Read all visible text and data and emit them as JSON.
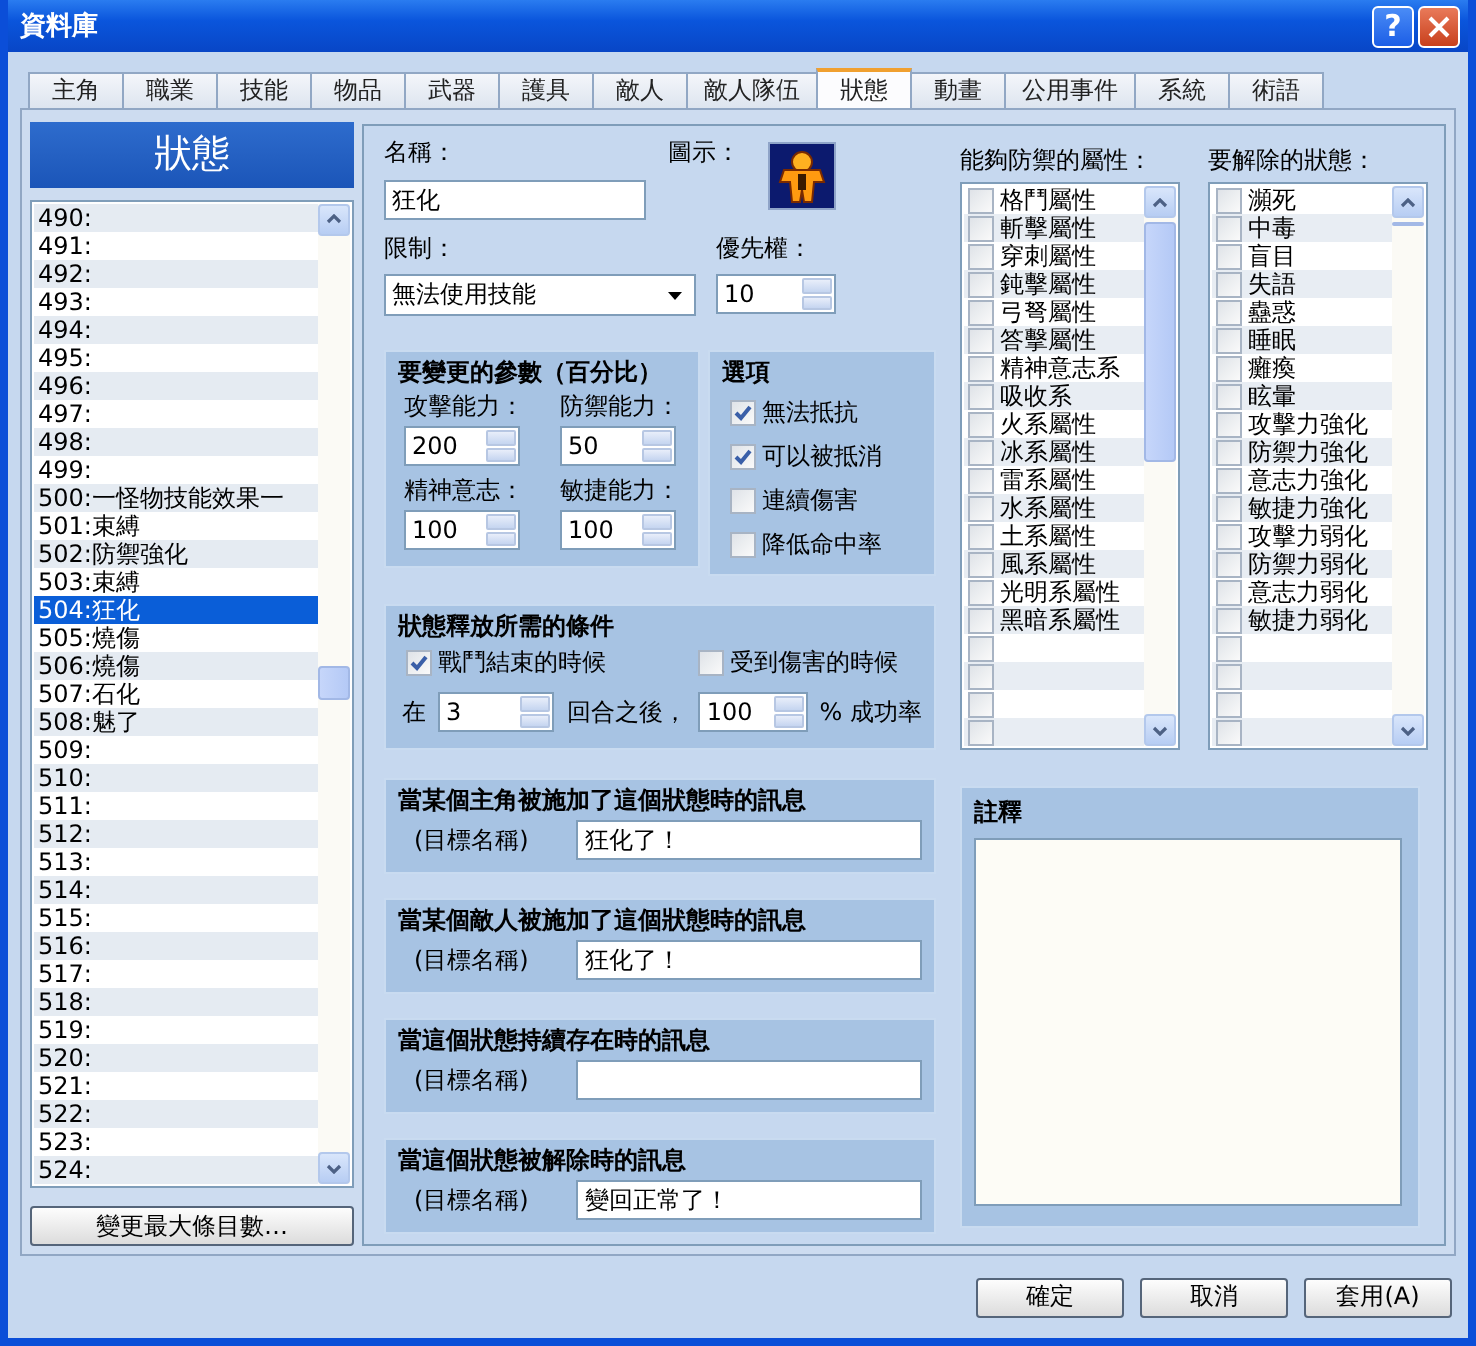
{
  "window": {
    "title": "資料庫",
    "help": "?"
  },
  "tabs": [
    {
      "label": "主角",
      "selected": false
    },
    {
      "label": "職業",
      "selected": false
    },
    {
      "label": "技能",
      "selected": false
    },
    {
      "label": "物品",
      "selected": false
    },
    {
      "label": "武器",
      "selected": false
    },
    {
      "label": "護具",
      "selected": false
    },
    {
      "label": "敵人",
      "selected": false
    },
    {
      "label": "敵人隊伍",
      "selected": false
    },
    {
      "label": "狀態",
      "selected": true
    },
    {
      "label": "動畫",
      "selected": false
    },
    {
      "label": "公用事件",
      "selected": false
    },
    {
      "label": "系統",
      "selected": false
    },
    {
      "label": "術語",
      "selected": false
    }
  ],
  "sidebar": {
    "title": "狀態",
    "button": "變更最大條目數…",
    "items": [
      {
        "label": "490:",
        "selected": false
      },
      {
        "label": "491:",
        "selected": false
      },
      {
        "label": "492:",
        "selected": false
      },
      {
        "label": "493:",
        "selected": false
      },
      {
        "label": "494:",
        "selected": false
      },
      {
        "label": "495:",
        "selected": false
      },
      {
        "label": "496:",
        "selected": false
      },
      {
        "label": "497:",
        "selected": false
      },
      {
        "label": "498:",
        "selected": false
      },
      {
        "label": "499:",
        "selected": false
      },
      {
        "label": "500:一怪物技能效果一",
        "selected": false
      },
      {
        "label": "501:束縛",
        "selected": false
      },
      {
        "label": "502:防禦強化",
        "selected": false
      },
      {
        "label": "503:束縛",
        "selected": false
      },
      {
        "label": "504:狂化",
        "selected": true
      },
      {
        "label": "505:燒傷",
        "selected": false
      },
      {
        "label": "506:燒傷",
        "selected": false
      },
      {
        "label": "507:石化",
        "selected": false
      },
      {
        "label": "508:魅了",
        "selected": false
      },
      {
        "label": "509:",
        "selected": false
      },
      {
        "label": "510:",
        "selected": false
      },
      {
        "label": "511:",
        "selected": false
      },
      {
        "label": "512:",
        "selected": false
      },
      {
        "label": "513:",
        "selected": false
      },
      {
        "label": "514:",
        "selected": false
      },
      {
        "label": "515:",
        "selected": false
      },
      {
        "label": "516:",
        "selected": false
      },
      {
        "label": "517:",
        "selected": false
      },
      {
        "label": "518:",
        "selected": false
      },
      {
        "label": "519:",
        "selected": false
      },
      {
        "label": "520:",
        "selected": false
      },
      {
        "label": "521:",
        "selected": false
      },
      {
        "label": "522:",
        "selected": false
      },
      {
        "label": "523:",
        "selected": false
      },
      {
        "label": "524:",
        "selected": false
      }
    ]
  },
  "form": {
    "name_label": "名稱：",
    "name_value": "狂化",
    "icon_label": "圖示：",
    "restriction_label": "限制：",
    "restriction_value": "無法使用技能",
    "priority_label": "優先權：",
    "priority_value": "10"
  },
  "parameters": {
    "title": "要變更的參數（百分比）",
    "fields": [
      {
        "label": "攻擊能力：",
        "value": "200"
      },
      {
        "label": "防禦能力：",
        "value": "50"
      },
      {
        "label": "精神意志：",
        "value": "100"
      },
      {
        "label": "敏捷能力：",
        "value": "100"
      }
    ]
  },
  "options": {
    "title": "選項",
    "items": [
      {
        "label": "無法抵抗",
        "checked": true
      },
      {
        "label": "可以被抵消",
        "checked": true
      },
      {
        "label": "連續傷害",
        "checked": false
      },
      {
        "label": "降低命中率",
        "checked": false
      }
    ]
  },
  "release": {
    "title": "狀態釋放所需的條件",
    "checks": [
      {
        "label": "戰鬥結束的時候",
        "checked": true
      },
      {
        "label": "受到傷害的時候",
        "checked": false
      }
    ],
    "prefix": "在",
    "turns": "3",
    "middle": "回合之後，",
    "rate": "100",
    "suffix": "% 成功率"
  },
  "messages": [
    {
      "title": "當某個主角被施加了這個狀態時的訊息",
      "label": "(目標名稱)",
      "value": "狂化了！"
    },
    {
      "title": "當某個敵人被施加了這個狀態時的訊息",
      "label": "(目標名稱)",
      "value": "狂化了！"
    },
    {
      "title": "當這個狀態持續存在時的訊息",
      "label": "(目標名稱)"
    },
    {
      "title": "當這個狀態被解除時的訊息",
      "label": "(目標名稱)",
      "value": "變回正常了！"
    }
  ],
  "elements": {
    "label": "能夠防禦的屬性：",
    "items": [
      {
        "label": "格鬥屬性",
        "checked": false
      },
      {
        "label": "斬擊屬性",
        "checked": false
      },
      {
        "label": "穿刺屬性",
        "checked": false
      },
      {
        "label": "鈍擊屬性",
        "checked": false
      },
      {
        "label": "弓弩屬性",
        "checked": false
      },
      {
        "label": "答擊屬性",
        "checked": false
      },
      {
        "label": "精神意志系",
        "checked": false
      },
      {
        "label": "吸收系",
        "checked": false
      },
      {
        "label": "火系屬性",
        "checked": false
      },
      {
        "label": "冰系屬性",
        "checked": false
      },
      {
        "label": "雷系屬性",
        "checked": false
      },
      {
        "label": "水系屬性",
        "checked": false
      },
      {
        "label": "土系屬性",
        "checked": false
      },
      {
        "label": "風系屬性",
        "checked": false
      },
      {
        "label": "光明系屬性",
        "checked": false
      },
      {
        "label": "黑暗系屬性",
        "checked": false
      },
      {
        "checked": false
      },
      {
        "checked": false
      },
      {
        "checked": false
      },
      {
        "checked": false
      }
    ]
  },
  "states_to_remove": {
    "label": "要解除的狀態：",
    "items": [
      {
        "label": "瀕死",
        "checked": false
      },
      {
        "label": "中毒",
        "checked": false
      },
      {
        "label": "盲目",
        "checked": false
      },
      {
        "label": "失語",
        "checked": false
      },
      {
        "label": "蠱惑",
        "checked": false
      },
      {
        "label": "睡眠",
        "checked": false
      },
      {
        "label": "癱瘓",
        "checked": false
      },
      {
        "label": "眩暈",
        "checked": false
      },
      {
        "label": "攻擊力強化",
        "checked": false
      },
      {
        "label": "防禦力強化",
        "checked": false
      },
      {
        "label": "意志力強化",
        "checked": false
      },
      {
        "label": "敏捷力強化",
        "checked": false
      },
      {
        "label": "攻擊力弱化",
        "checked": false
      },
      {
        "label": "防禦力弱化",
        "checked": false
      },
      {
        "label": "意志力弱化",
        "checked": false
      },
      {
        "label": "敏捷力弱化",
        "checked": false
      },
      {
        "checked": false
      },
      {
        "checked": false
      },
      {
        "checked": false
      },
      {
        "checked": false
      }
    ]
  },
  "notes": {
    "title": "註釋"
  },
  "buttons": [
    "確定",
    "取消",
    "套用(A)"
  ]
}
